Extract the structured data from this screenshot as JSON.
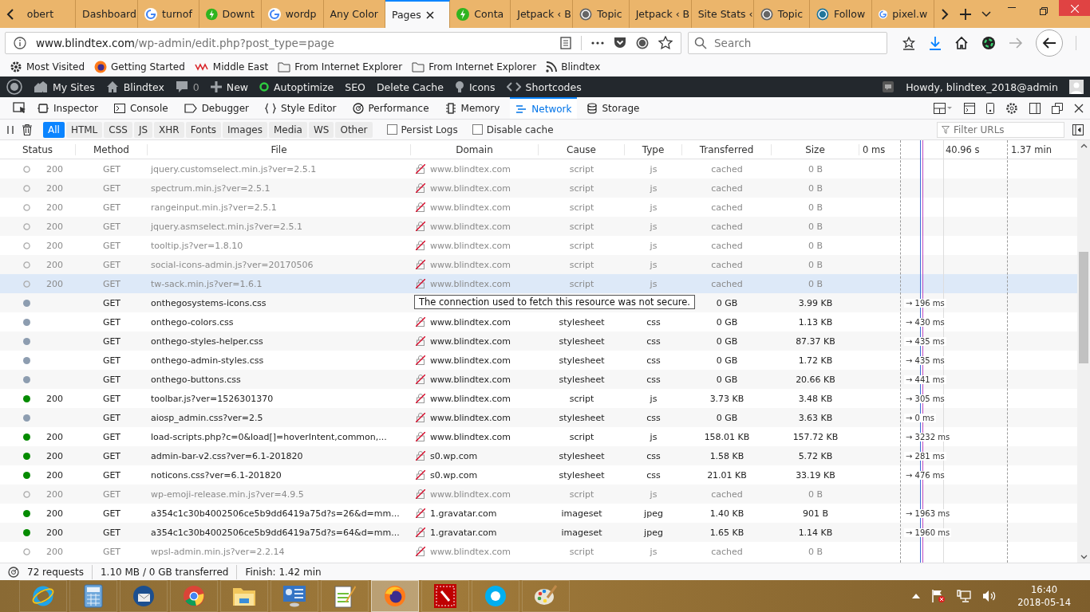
{
  "browser_tabs": [
    {
      "label": "obert",
      "kind": "plain",
      "selected": false
    },
    {
      "label": "Dashboard",
      "kind": "plain",
      "selected": false
    },
    {
      "label": "turnof",
      "kind": "google",
      "selected": false
    },
    {
      "label": "Downt",
      "kind": "bolt",
      "selected": false
    },
    {
      "label": "wordp",
      "kind": "google",
      "selected": false
    },
    {
      "label": "Any Color",
      "kind": "plain",
      "selected": false
    },
    {
      "label": "Pages",
      "kind": "plain",
      "selected": true
    },
    {
      "label": "Conta",
      "kind": "bolt",
      "selected": false
    },
    {
      "label": "Jetpack ‹ B",
      "kind": "plain",
      "selected": false
    },
    {
      "label": "Topic",
      "kind": "wp",
      "selected": false
    },
    {
      "label": "Jetpack ‹ B",
      "kind": "plain",
      "selected": false
    },
    {
      "label": "Site Stats ‹",
      "kind": "plain",
      "selected": false
    },
    {
      "label": "Topic",
      "kind": "wp",
      "selected": false
    },
    {
      "label": "Follow",
      "kind": "wpblue",
      "selected": false
    },
    {
      "label": "pixel.w",
      "kind": "google",
      "selected": false
    }
  ],
  "address_bar": {
    "domain": "www.blindtex.com",
    "path": "/wp-admin/edit.php?post_type=page"
  },
  "search": {
    "placeholder": "Search"
  },
  "bookmarks": [
    {
      "label": "Most Visited",
      "kind": "gear"
    },
    {
      "label": "Getting Started",
      "kind": "firefox"
    },
    {
      "label": "Middle East",
      "kind": "wsp"
    },
    {
      "label": "From Internet Explorer",
      "kind": "folder"
    },
    {
      "label": "From Internet Explorer",
      "kind": "folder"
    },
    {
      "label": "Blindtex",
      "kind": "rss"
    }
  ],
  "admin_bar": {
    "items": [
      {
        "label": "My Sites",
        "kind": "sites"
      },
      {
        "label": "Blindtex",
        "kind": "home"
      },
      {
        "label": "0",
        "kind": "comment"
      },
      {
        "label": "New",
        "kind": "plus"
      },
      {
        "label": "Autoptimize",
        "kind": "ring"
      },
      {
        "label": "SEO",
        "kind": "plain"
      },
      {
        "label": "Delete Cache",
        "kind": "plain"
      },
      {
        "label": "Icons",
        "kind": "bulb"
      },
      {
        "label": "Shortcodes",
        "kind": "code"
      }
    ],
    "greeting": "Howdy, blindtex_2018@admin"
  },
  "devtools_tabs": [
    {
      "label": "Inspector",
      "selected": false
    },
    {
      "label": "Console",
      "selected": false
    },
    {
      "label": "Debugger",
      "selected": false
    },
    {
      "label": "Style Editor",
      "selected": false
    },
    {
      "label": "Performance",
      "selected": false
    },
    {
      "label": "Memory",
      "selected": false
    },
    {
      "label": "Network",
      "selected": true
    },
    {
      "label": "Storage",
      "selected": false
    }
  ],
  "filters": [
    {
      "label": "All",
      "selected": true
    },
    {
      "label": "HTML",
      "selected": false
    },
    {
      "label": "CSS",
      "selected": false
    },
    {
      "label": "JS",
      "selected": false
    },
    {
      "label": "XHR",
      "selected": false
    },
    {
      "label": "Fonts",
      "selected": false
    },
    {
      "label": "Images",
      "selected": false
    },
    {
      "label": "Media",
      "selected": false
    },
    {
      "label": "WS",
      "selected": false
    },
    {
      "label": "Other",
      "selected": false
    }
  ],
  "options": [
    {
      "label": "Persist Logs",
      "checked": false
    },
    {
      "label": "Disable cache",
      "checked": false
    }
  ],
  "filter_urls": {
    "placeholder": "Filter URLs"
  },
  "columns": [
    "Status",
    "Method",
    "File",
    "Domain",
    "Cause",
    "Type",
    "Transferred",
    "Size"
  ],
  "waterfall_ticks": [
    "0 ms",
    "40.96 s",
    "1.37 min"
  ],
  "rows": [
    {
      "kind": "cached",
      "selected": false,
      "status": "200",
      "method": "GET",
      "file": "jquery.customselect.min.js?ver=2.5.1",
      "domain": "www.blindtex.com",
      "cause": "script",
      "type": "js",
      "transferred": "cached",
      "size": "0 B"
    },
    {
      "kind": "cached",
      "selected": false,
      "status": "200",
      "method": "GET",
      "file": "spectrum.min.js?ver=2.5.1",
      "domain": "www.blindtex.com",
      "cause": "script",
      "type": "js",
      "transferred": "cached",
      "size": "0 B"
    },
    {
      "kind": "cached",
      "selected": false,
      "status": "200",
      "method": "GET",
      "file": "rangeinput.min.js?ver=2.5.1",
      "domain": "www.blindtex.com",
      "cause": "script",
      "type": "js",
      "transferred": "cached",
      "size": "0 B"
    },
    {
      "kind": "cached",
      "selected": false,
      "status": "200",
      "method": "GET",
      "file": "jquery.asmselect.min.js?ver=2.5.1",
      "domain": "www.blindtex.com",
      "cause": "script",
      "type": "js",
      "transferred": "cached",
      "size": "0 B"
    },
    {
      "kind": "cached",
      "selected": false,
      "status": "200",
      "method": "GET",
      "file": "tooltip.js?ver=1.8.10",
      "domain": "www.blindtex.com",
      "cause": "script",
      "type": "js",
      "transferred": "cached",
      "size": "0 B"
    },
    {
      "kind": "cached",
      "selected": false,
      "status": "200",
      "method": "GET",
      "file": "social-icons-admin.js?ver=20170506",
      "domain": "www.blindtex.com",
      "cause": "script",
      "type": "js",
      "transferred": "cached",
      "size": "0 B"
    },
    {
      "kind": "cached",
      "selected": true,
      "status": "200",
      "method": "GET",
      "file": "tw-sack.min.js?ver=1.6.1",
      "domain": "www.blindtex.com",
      "cause": "script",
      "type": "js",
      "transferred": "cached",
      "size": "0 B"
    },
    {
      "kind": "pending",
      "selected": false,
      "method": "GET",
      "file": "onthegosystems-icons.css",
      "tooltip": "The connection used to fetch this resource was not secure.",
      "transferred": "0 GB",
      "size": "3.99 KB",
      "timing": "→ 196 ms"
    },
    {
      "kind": "pending",
      "selected": false,
      "method": "GET",
      "file": "onthego-colors.css",
      "domain": "www.blindtex.com",
      "cause": "stylesheet",
      "type": "css",
      "transferred": "0 GB",
      "size": "1.13 KB",
      "timing": "→ 430 ms"
    },
    {
      "kind": "pending",
      "selected": false,
      "method": "GET",
      "file": "onthego-styles-helper.css",
      "domain": "www.blindtex.com",
      "cause": "stylesheet",
      "type": "css",
      "transferred": "0 GB",
      "size": "87.37 KB",
      "timing": "→ 435 ms"
    },
    {
      "kind": "pending",
      "selected": false,
      "method": "GET",
      "file": "onthego-admin-styles.css",
      "domain": "www.blindtex.com",
      "cause": "stylesheet",
      "type": "css",
      "transferred": "0 GB",
      "size": "1.72 KB",
      "timing": "→ 435 ms"
    },
    {
      "kind": "pending",
      "selected": false,
      "method": "GET",
      "file": "onthego-buttons.css",
      "domain": "www.blindtex.com",
      "cause": "stylesheet",
      "type": "css",
      "transferred": "0 GB",
      "size": "20.66 KB",
      "timing": "→ 441 ms"
    },
    {
      "kind": "ok",
      "selected": false,
      "status": "200",
      "method": "GET",
      "file": "toolbar.js?ver=1526301370",
      "domain": "www.blindtex.com",
      "cause": "script",
      "type": "js",
      "transferred": "3.73 KB",
      "size": "3.48 KB",
      "timing": "→ 305 ms"
    },
    {
      "kind": "pending",
      "selected": false,
      "method": "GET",
      "file": "aiosp_admin.css?ver=2.5",
      "domain": "www.blindtex.com",
      "cause": "stylesheet",
      "type": "css",
      "transferred": "0 GB",
      "size": "3.63 KB",
      "timing": "→ 0 ms"
    },
    {
      "kind": "ok",
      "selected": false,
      "status": "200",
      "method": "GET",
      "file": "load-scripts.php?c=0&load[]=hoverIntent,common,...",
      "domain": "www.blindtex.com",
      "cause": "script",
      "type": "js",
      "transferred": "158.01 KB",
      "size": "157.72 KB",
      "timing": "→ 3232 ms"
    },
    {
      "kind": "ok",
      "selected": false,
      "status": "200",
      "method": "GET",
      "file": "admin-bar-v2.css?ver=6.1-201820",
      "domain": "s0.wp.com",
      "cause": "stylesheet",
      "type": "css",
      "transferred": "1.58 KB",
      "size": "5.72 KB",
      "timing": "→ 281 ms"
    },
    {
      "kind": "ok",
      "selected": false,
      "status": "200",
      "method": "GET",
      "file": "noticons.css?ver=6.1-201820",
      "domain": "s0.wp.com",
      "cause": "stylesheet",
      "type": "css",
      "transferred": "21.01 KB",
      "size": "33.19 KB",
      "timing": "→ 476 ms"
    },
    {
      "kind": "cached",
      "selected": false,
      "status": "200",
      "method": "GET",
      "file": "wp-emoji-release.min.js?ver=4.9.5",
      "domain": "www.blindtex.com",
      "cause": "script",
      "type": "js",
      "transferred": "cached",
      "size": "0 B"
    },
    {
      "kind": "ok",
      "selected": false,
      "status": "200",
      "method": "GET",
      "file": "a354c1c30b4002506ce5b9dd6419a75d?s=26&d=mm...",
      "domain": "1.gravatar.com",
      "cause": "imageset",
      "type": "jpeg",
      "transferred": "1.40 KB",
      "size": "901 B",
      "timing": "→ 1963 ms"
    },
    {
      "kind": "ok",
      "selected": false,
      "status": "200",
      "method": "GET",
      "file": "a354c1c30b4002506ce5b9dd6419a75d?s=64&d=mm...",
      "domain": "1.gravatar.com",
      "cause": "imageset",
      "type": "jpeg",
      "transferred": "1.65 KB",
      "size": "1.14 KB",
      "timing": "→ 1960 ms"
    },
    {
      "kind": "cached",
      "selected": false,
      "status": "200",
      "method": "GET",
      "file": "wpsl-admin.min.js?ver=2.2.14",
      "domain": "www.blindtex.com",
      "cause": "script",
      "type": "js",
      "transferred": "cached",
      "size": "0 B"
    }
  ],
  "status_bar": [
    "72 requests",
    "1.10 MB / 0 GB transferred",
    "Finish: 1.42 min"
  ],
  "taskbar": {
    "apps": [
      {
        "kind": "ie",
        "selected": false
      },
      {
        "kind": "calculator",
        "selected": false
      },
      {
        "kind": "thunderbird",
        "selected": false
      },
      {
        "kind": "chrome",
        "selected": false
      },
      {
        "kind": "explorer",
        "selected": false
      },
      {
        "kind": "control",
        "selected": false
      },
      {
        "kind": "notepad",
        "selected": false
      },
      {
        "kind": "firefox",
        "selected": true
      },
      {
        "kind": "filezilla",
        "selected": false
      },
      {
        "kind": "skype",
        "selected": false
      },
      {
        "kind": "paint",
        "selected": false
      }
    ],
    "time": "16:40",
    "date": "2018-05-14"
  }
}
